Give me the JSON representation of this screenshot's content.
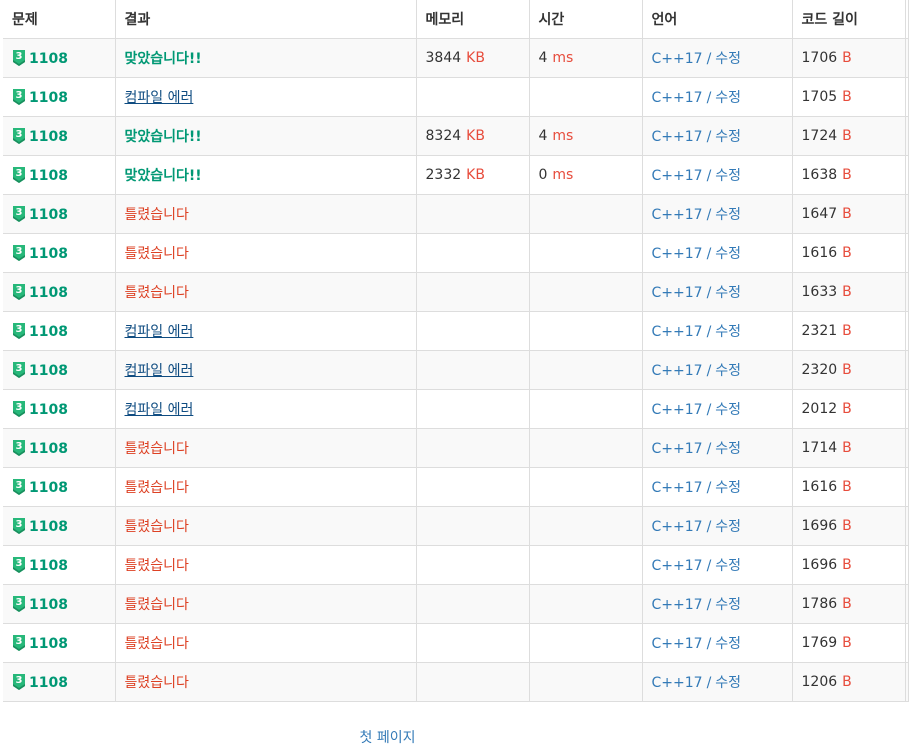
{
  "table": {
    "headers": [
      "문제",
      "결과",
      "메모리",
      "시간",
      "언어",
      "코드 길이"
    ],
    "rows": [
      {
        "problem": "1108",
        "tier": "3",
        "result": "맞았습니다!!",
        "result_type": "ac",
        "memory": "3844",
        "memory_unit": "KB",
        "time": "4",
        "time_unit": "ms",
        "language": "C++17",
        "edit": "수정",
        "length": "1706",
        "length_unit": "B"
      },
      {
        "problem": "1108",
        "tier": "3",
        "result": "컴파일 에러",
        "result_type": "ce",
        "memory": "",
        "memory_unit": "",
        "time": "",
        "time_unit": "",
        "language": "C++17",
        "edit": "수정",
        "length": "1705",
        "length_unit": "B"
      },
      {
        "problem": "1108",
        "tier": "3",
        "result": "맞았습니다!!",
        "result_type": "ac",
        "memory": "8324",
        "memory_unit": "KB",
        "time": "4",
        "time_unit": "ms",
        "language": "C++17",
        "edit": "수정",
        "length": "1724",
        "length_unit": "B"
      },
      {
        "problem": "1108",
        "tier": "3",
        "result": "맞았습니다!!",
        "result_type": "ac",
        "memory": "2332",
        "memory_unit": "KB",
        "time": "0",
        "time_unit": "ms",
        "language": "C++17",
        "edit": "수정",
        "length": "1638",
        "length_unit": "B"
      },
      {
        "problem": "1108",
        "tier": "3",
        "result": "틀렸습니다",
        "result_type": "wa",
        "memory": "",
        "memory_unit": "",
        "time": "",
        "time_unit": "",
        "language": "C++17",
        "edit": "수정",
        "length": "1647",
        "length_unit": "B"
      },
      {
        "problem": "1108",
        "tier": "3",
        "result": "틀렸습니다",
        "result_type": "wa",
        "memory": "",
        "memory_unit": "",
        "time": "",
        "time_unit": "",
        "language": "C++17",
        "edit": "수정",
        "length": "1616",
        "length_unit": "B"
      },
      {
        "problem": "1108",
        "tier": "3",
        "result": "틀렸습니다",
        "result_type": "wa",
        "memory": "",
        "memory_unit": "",
        "time": "",
        "time_unit": "",
        "language": "C++17",
        "edit": "수정",
        "length": "1633",
        "length_unit": "B"
      },
      {
        "problem": "1108",
        "tier": "3",
        "result": "컴파일 에러",
        "result_type": "ce",
        "memory": "",
        "memory_unit": "",
        "time": "",
        "time_unit": "",
        "language": "C++17",
        "edit": "수정",
        "length": "2321",
        "length_unit": "B"
      },
      {
        "problem": "1108",
        "tier": "3",
        "result": "컴파일 에러",
        "result_type": "ce",
        "memory": "",
        "memory_unit": "",
        "time": "",
        "time_unit": "",
        "language": "C++17",
        "edit": "수정",
        "length": "2320",
        "length_unit": "B"
      },
      {
        "problem": "1108",
        "tier": "3",
        "result": "컴파일 에러",
        "result_type": "ce",
        "memory": "",
        "memory_unit": "",
        "time": "",
        "time_unit": "",
        "language": "C++17",
        "edit": "수정",
        "length": "2012",
        "length_unit": "B"
      },
      {
        "problem": "1108",
        "tier": "3",
        "result": "틀렸습니다",
        "result_type": "wa",
        "memory": "",
        "memory_unit": "",
        "time": "",
        "time_unit": "",
        "language": "C++17",
        "edit": "수정",
        "length": "1714",
        "length_unit": "B"
      },
      {
        "problem": "1108",
        "tier": "3",
        "result": "틀렸습니다",
        "result_type": "wa",
        "memory": "",
        "memory_unit": "",
        "time": "",
        "time_unit": "",
        "language": "C++17",
        "edit": "수정",
        "length": "1616",
        "length_unit": "B"
      },
      {
        "problem": "1108",
        "tier": "3",
        "result": "틀렸습니다",
        "result_type": "wa",
        "memory": "",
        "memory_unit": "",
        "time": "",
        "time_unit": "",
        "language": "C++17",
        "edit": "수정",
        "length": "1696",
        "length_unit": "B"
      },
      {
        "problem": "1108",
        "tier": "3",
        "result": "틀렸습니다",
        "result_type": "wa",
        "memory": "",
        "memory_unit": "",
        "time": "",
        "time_unit": "",
        "language": "C++17",
        "edit": "수정",
        "length": "1696",
        "length_unit": "B"
      },
      {
        "problem": "1108",
        "tier": "3",
        "result": "틀렸습니다",
        "result_type": "wa",
        "memory": "",
        "memory_unit": "",
        "time": "",
        "time_unit": "",
        "language": "C++17",
        "edit": "수정",
        "length": "1786",
        "length_unit": "B"
      },
      {
        "problem": "1108",
        "tier": "3",
        "result": "틀렸습니다",
        "result_type": "wa",
        "memory": "",
        "memory_unit": "",
        "time": "",
        "time_unit": "",
        "language": "C++17",
        "edit": "수정",
        "length": "1769",
        "length_unit": "B"
      },
      {
        "problem": "1108",
        "tier": "3",
        "result": "틀렸습니다",
        "result_type": "wa",
        "memory": "",
        "memory_unit": "",
        "time": "",
        "time_unit": "",
        "language": "C++17",
        "edit": "수정",
        "length": "1206",
        "length_unit": "B"
      }
    ]
  },
  "pagination": {
    "first_page": "첫 페이지"
  },
  "colors": {
    "accepted": "#009874",
    "wrong": "#dd4124",
    "compile_error": "#0f4c81",
    "link": "#337ab7",
    "unit": "#e74c3c",
    "tier_badge": "#27b87a"
  },
  "icons": {
    "tier": "gold-tier-badge-icon"
  }
}
